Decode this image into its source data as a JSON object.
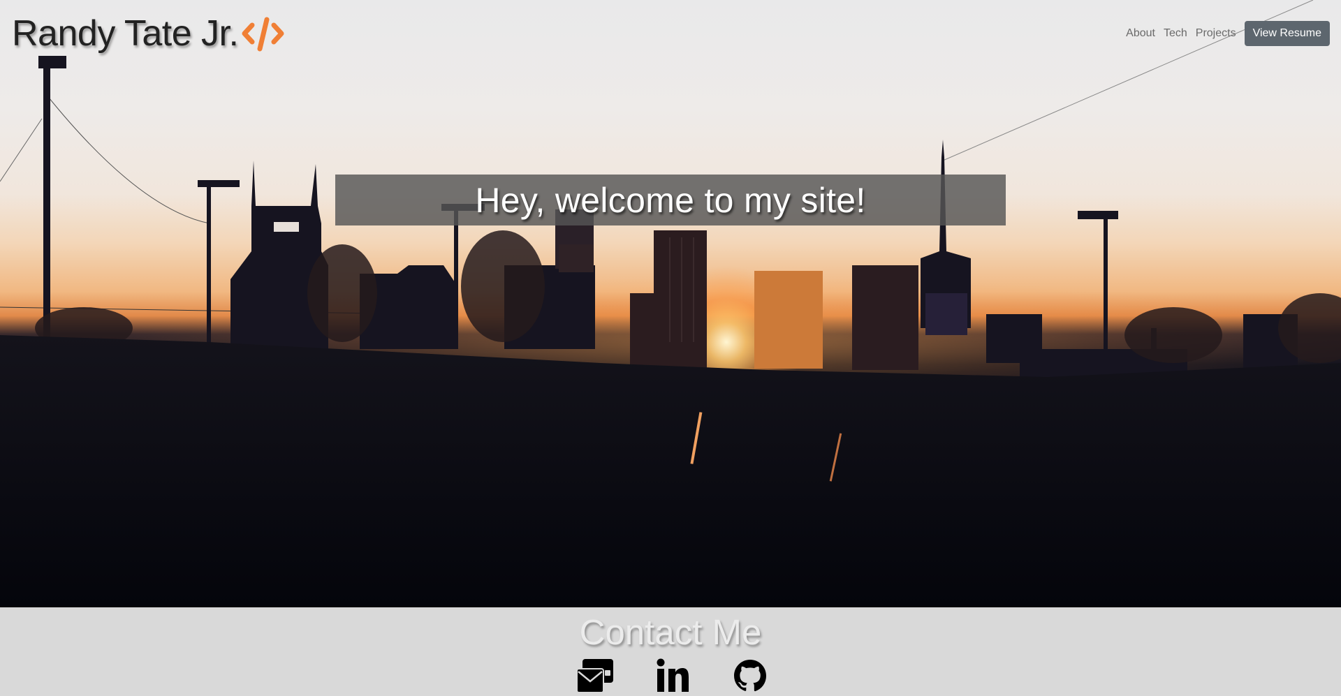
{
  "header": {
    "brand_name": "Randy Tate Jr.",
    "brand_icon": "code-icon",
    "nav": {
      "about": "About",
      "tech": "Tech",
      "projects": "Projects",
      "resume": "View Resume"
    }
  },
  "hero": {
    "welcome": "Hey, welcome to my site!",
    "background": "city-skyline-sunset-photo"
  },
  "contact": {
    "title": "Contact Me",
    "icons": [
      "email-icon",
      "linkedin-icon",
      "github-icon"
    ],
    "linkedin_text": "in"
  },
  "colors": {
    "accent": "#f07f35",
    "resume_button": "#5d666e",
    "welcome_banner": "#555555",
    "contact_bg": "#d9d9d9"
  }
}
